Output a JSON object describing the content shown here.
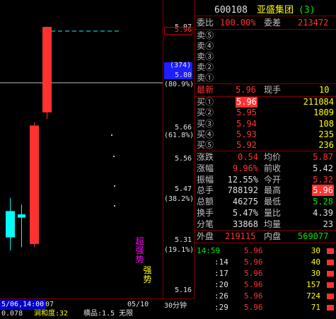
{
  "stock": {
    "code": "600108",
    "name": "亚盛集团",
    "number": "(3)"
  },
  "header": {
    "weibi_label": "委比",
    "weibi_value": "100.00%",
    "weicha_label": "委差",
    "weicha_value": "213472"
  },
  "sell_labels": [
    "卖⑤",
    "卖④",
    "卖③",
    "卖②",
    "卖①"
  ],
  "latest": {
    "label": "最新",
    "value": "5.96",
    "xianshou_label": "现手",
    "xianshou_value": "10"
  },
  "buy": [
    {
      "label": "买①",
      "price": "5.96",
      "vol": "211084"
    },
    {
      "label": "买②",
      "price": "5.95",
      "vol": "1809"
    },
    {
      "label": "买③",
      "price": "5.94",
      "vol": "108"
    },
    {
      "label": "买④",
      "price": "5.93",
      "vol": "235"
    },
    {
      "label": "买⑤",
      "price": "5.92",
      "vol": "236"
    }
  ],
  "stats": [
    {
      "l1": "涨跌",
      "v1": "0.54",
      "l2": "均价",
      "v2": "5.87"
    },
    {
      "l1": "涨幅",
      "v1": "9.96%",
      "l2": "前收",
      "v2": "5.42"
    },
    {
      "l1": "振幅",
      "v1": "12.55%",
      "l2": "今开",
      "v2": "5.32"
    },
    {
      "l1": "总手",
      "v1": "788192",
      "l2": "最高",
      "v2": "5.96"
    },
    {
      "l1": "总额",
      "v1": "46275",
      "l2": "最低",
      "v2": "5.28"
    },
    {
      "l1": "换手",
      "v1": "5.47%",
      "l2": "量比",
      "v2": "4.39"
    },
    {
      "l1": "分笔",
      "v1": "33868",
      "l2": "均量",
      "v2": "23"
    }
  ],
  "panels": {
    "waipan_label": "外盘",
    "waipan_value": "219115",
    "neipan_label": "内盘",
    "neipan_value": "569077"
  },
  "ticks": [
    {
      "time": "14:59",
      "price": "5.96",
      "vol": "30"
    },
    {
      "time": ":14",
      "price": "5.96",
      "vol": "40"
    },
    {
      "time": ":17",
      "price": "5.96",
      "vol": "30"
    },
    {
      "time": ":20",
      "price": "5.96",
      "vol": "157"
    },
    {
      "time": ":26",
      "price": "5.96",
      "vol": "724"
    },
    {
      "time": ":29",
      "price": "5.96",
      "vol": "71"
    }
  ],
  "axis": {
    "p1": "5.97",
    "p2": "5.96",
    "p3": "(374)",
    "p4": "5.80",
    "p5": "(80.9%)",
    "p6": "5.66",
    "p7": "(61.8%)",
    "p8": "5.56",
    "p9": "5.47",
    "p10": "(38.2%)",
    "p11": "5.31",
    "p12": "(19.1%)",
    "p13": "5.16"
  },
  "annot": {
    "chaoqiang": "超强势",
    "qiangshi": "强势"
  },
  "bottom": {
    "date": "5/06,14:00",
    "num": "07",
    "mid": "05/10",
    "period": "30分钟",
    "b1": "0.078",
    "b2": "涧和度:32",
    "b3": "横品:1.5 无限"
  },
  "chart_data": {
    "type": "candlestick",
    "candles": [
      {
        "open": 5.32,
        "close": 5.4,
        "high": 5.44,
        "low": 5.28,
        "color": "#00ffff"
      },
      {
        "open": 5.39,
        "close": 5.38,
        "high": 5.42,
        "low": 5.29,
        "color": "#00ffff"
      },
      {
        "open": 5.3,
        "close": 5.66,
        "high": 5.67,
        "low": 5.29,
        "color": "#ff3232"
      },
      {
        "open": 5.7,
        "close": 5.96,
        "high": 5.96,
        "low": 5.68,
        "color": "#ff3232"
      }
    ]
  }
}
